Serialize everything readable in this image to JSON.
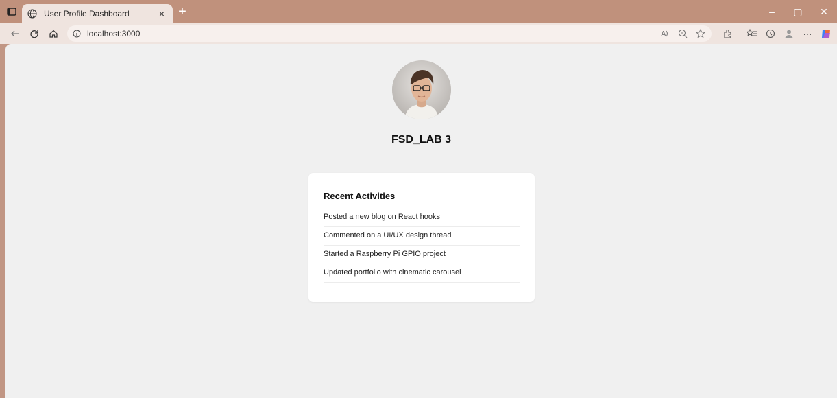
{
  "browser": {
    "tab": {
      "title": "User Profile Dashboard",
      "close_glyph": "×"
    },
    "new_tab_glyph": "+",
    "address": {
      "url": "localhost:3000"
    },
    "window_controls": {
      "minimize": "–",
      "maximize": "▢",
      "close": "✕"
    },
    "toolbar_more": "···",
    "icons": [
      "tab-actions-icon",
      "globe-icon",
      "back-icon",
      "refresh-icon",
      "home-icon",
      "info-icon",
      "read-aloud-icon",
      "zoom-icon",
      "favorite-icon",
      "extensions-icon",
      "favorites-icon",
      "history-icon",
      "profile-icon",
      "more-icon",
      "copilot-icon"
    ]
  },
  "profile": {
    "name": "FSD_LAB 3"
  },
  "activities": {
    "title": "Recent Activities",
    "items": [
      "Posted a new blog on React hooks",
      "Commented on a UI/UX design thread",
      "Started a Raspberry Pi GPIO project",
      "Updated portfolio with cinematic carousel"
    ]
  },
  "colors": {
    "titlebar": "#c0917c",
    "toolbar": "#efe4df",
    "page_bg": "#f0f0f0",
    "card_bg": "#ffffff"
  }
}
